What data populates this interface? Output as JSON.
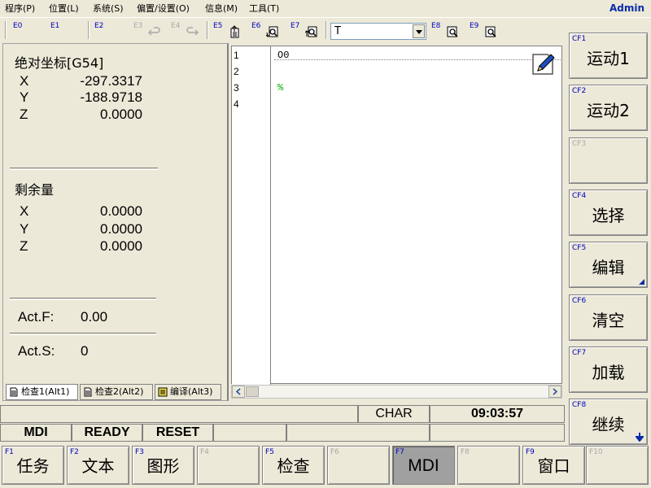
{
  "menubar": {
    "items": [
      {
        "label": "程序(P)"
      },
      {
        "label": "位置(L)"
      },
      {
        "label": "系统(S)"
      },
      {
        "label": "偏置/设置(O)"
      },
      {
        "label": "信息(M)"
      },
      {
        "label": "工具(T)"
      }
    ],
    "user": "Admin"
  },
  "toolbar": {
    "keys": [
      "E0",
      "E1",
      "E2",
      "E3",
      "E4",
      "E5",
      "E6",
      "E7",
      "E8",
      "E9"
    ],
    "combo_value": "T"
  },
  "position": {
    "absolute": {
      "title": "绝对坐标[G54]",
      "axes": [
        {
          "axis": "X",
          "value": "-297.3317"
        },
        {
          "axis": "Y",
          "value": "-188.9718"
        },
        {
          "axis": "Z",
          "value": "0.0000"
        }
      ]
    },
    "remaining": {
      "title": "剩余量",
      "axes": [
        {
          "axis": "X",
          "value": "0.0000"
        },
        {
          "axis": "Y",
          "value": "0.0000"
        },
        {
          "axis": "Z",
          "value": "0.0000"
        }
      ]
    },
    "act_f": {
      "label": "Act.F:",
      "value": "0.00"
    },
    "act_s": {
      "label": "Act.S:",
      "value": "0"
    }
  },
  "left_tabs": [
    {
      "label": "检查1(Alt1)"
    },
    {
      "label": "检查2(Alt2)"
    },
    {
      "label": "编译(Alt3)"
    }
  ],
  "editor": {
    "line_numbers": [
      "1",
      "2",
      "3",
      "4"
    ],
    "lines": [
      {
        "text": "O0"
      },
      {
        "text": ""
      },
      {
        "text": "%"
      },
      {
        "text": ""
      }
    ]
  },
  "status": {
    "char": "CHAR",
    "time": "09:03:57",
    "mode": "MDI",
    "state": "READY",
    "reset": "RESET"
  },
  "cf_buttons": [
    {
      "key": "CF1",
      "label": "运动1"
    },
    {
      "key": "CF2",
      "label": "运动2"
    },
    {
      "key": "CF3",
      "label": ""
    },
    {
      "key": "CF4",
      "label": "选择"
    },
    {
      "key": "CF5",
      "label": "编辑"
    },
    {
      "key": "CF6",
      "label": "清空"
    },
    {
      "key": "CF7",
      "label": "加载"
    },
    {
      "key": "CF8",
      "label": "继续"
    }
  ],
  "f_buttons": [
    {
      "key": "F1",
      "label": "任务"
    },
    {
      "key": "F2",
      "label": "文本"
    },
    {
      "key": "F3",
      "label": "图形"
    },
    {
      "key": "F4",
      "label": ""
    },
    {
      "key": "F5",
      "label": "检查"
    },
    {
      "key": "F6",
      "label": ""
    },
    {
      "key": "F7",
      "label": "MDI"
    },
    {
      "key": "F8",
      "label": ""
    },
    {
      "key": "F9",
      "label": "窗口"
    },
    {
      "key": "F10",
      "label": ""
    }
  ],
  "colors": {
    "background": "#ece9d8",
    "key_label": "#0000c0",
    "disabled": "#a9a9a9",
    "code_comment": "#00b000",
    "active_button": "#a0a0a0"
  }
}
